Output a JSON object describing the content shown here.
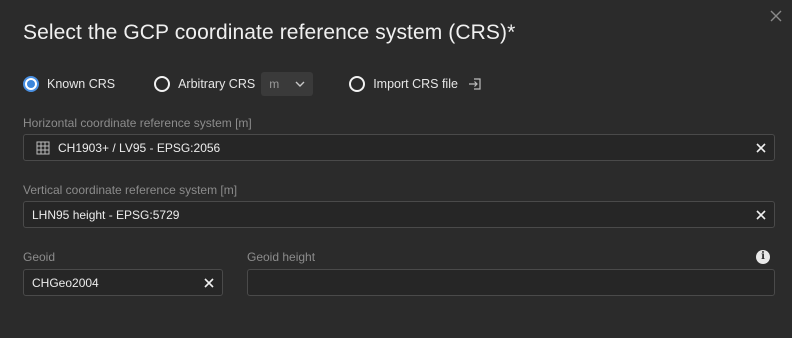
{
  "dialog": {
    "title": "Select the GCP coordinate reference system (CRS)*",
    "close_icon": "close-icon"
  },
  "crs_options": {
    "known": {
      "label": "Known CRS",
      "checked": true
    },
    "arbitrary": {
      "label": "Arbitrary CRS",
      "checked": false,
      "unit_value": "m"
    },
    "import": {
      "label": "Import CRS file",
      "checked": false,
      "icon": "import-icon"
    }
  },
  "horizontal": {
    "label": "Horizontal coordinate reference system [m]",
    "value": "CH1903+ / LV95 - EPSG:2056",
    "icon": "grid-icon"
  },
  "vertical": {
    "label": "Vertical coordinate reference system [m]",
    "value": "LHN95 height - EPSG:5729"
  },
  "geoid": {
    "label": "Geoid",
    "value": "CHGeo2004"
  },
  "geoid_height": {
    "label": "Geoid height",
    "value": "",
    "info_icon": "info-icon"
  },
  "colors": {
    "background": "#2b2b2b",
    "field_background": "#262626",
    "field_border": "#4a4a4a",
    "accent": "#3d86da",
    "label": "#8c8c8c"
  }
}
